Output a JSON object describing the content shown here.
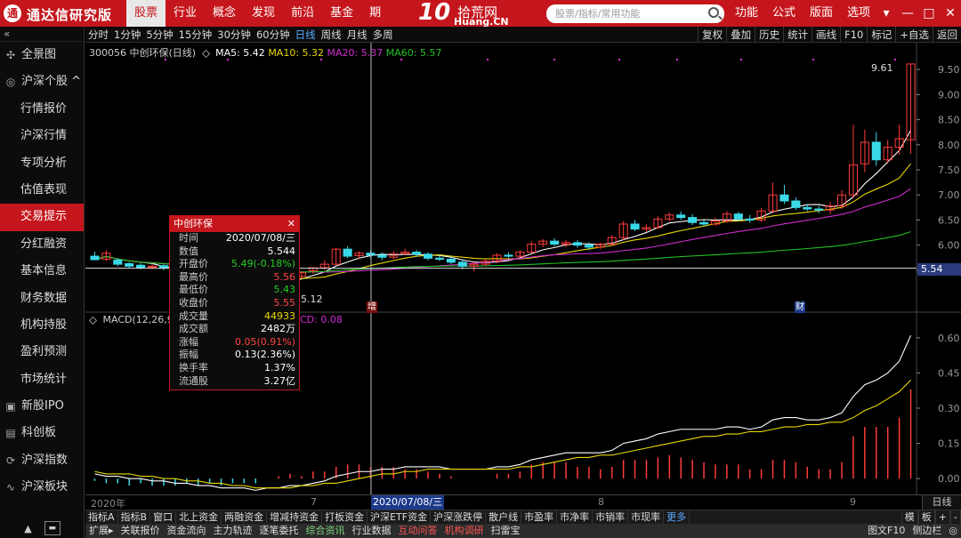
{
  "app": {
    "name": "通达信研究版",
    "logo": "通"
  },
  "menu": {
    "items": [
      "股票",
      "行业",
      "概念",
      "发现",
      "前沿",
      "基金",
      "期"
    ],
    "active": 0,
    "right": [
      "功能",
      "公式",
      "版面",
      "选项"
    ]
  },
  "watermark": {
    "big": "10",
    "t1": "拾荒网",
    "t2": "Huang.CN"
  },
  "search": {
    "placeholder": "股票/指标/常用功能"
  },
  "window": {
    "controls": [
      "▾",
      "—",
      "□",
      "✕"
    ]
  },
  "sidebar": {
    "collapse": "«",
    "items": [
      {
        "label": "全景图",
        "icon": "✣",
        "sub": false
      },
      {
        "label": "沪深个股 ^",
        "icon": "◎",
        "sub": false
      },
      {
        "label": "行情报价",
        "icon": "",
        "sub": true
      },
      {
        "label": "沪深行情",
        "icon": "",
        "sub": true
      },
      {
        "label": "专项分析",
        "icon": "",
        "sub": true
      },
      {
        "label": "估值表现",
        "icon": "",
        "sub": true
      },
      {
        "label": "交易提示",
        "icon": "",
        "sub": true,
        "active": true
      },
      {
        "label": "分红融资",
        "icon": "",
        "sub": true
      },
      {
        "label": "基本信息",
        "icon": "",
        "sub": true
      },
      {
        "label": "财务数据",
        "icon": "",
        "sub": true
      },
      {
        "label": "机构持股",
        "icon": "",
        "sub": true
      },
      {
        "label": "盈利预测",
        "icon": "",
        "sub": true
      },
      {
        "label": "市场统计",
        "icon": "",
        "sub": true
      },
      {
        "label": "新股IPO",
        "icon": "▣",
        "sub": false
      },
      {
        "label": "科创板",
        "icon": "▤",
        "sub": false
      },
      {
        "label": "沪深指数",
        "icon": "⟳",
        "sub": false
      },
      {
        "label": "沪深板块",
        "icon": "∿",
        "sub": false
      }
    ],
    "bottom": {
      "arrow": "▲",
      "btn": "▬"
    }
  },
  "periods": {
    "items": [
      "分时",
      "1分钟",
      "5分钟",
      "15分钟",
      "30分钟",
      "60分钟",
      "日线",
      "周线",
      "月线",
      "多周"
    ],
    "selected": 6,
    "tools": [
      "复权",
      "叠加",
      "历史",
      "统计",
      "画线",
      "F10",
      "标记",
      "+自选",
      "返回"
    ]
  },
  "stock": {
    "code": "300056",
    "name": "中创环保(日线)",
    "ma5": "MA5: 5.42",
    "ma10": "MA10: 5.32",
    "ma20": "MA20: 5.37",
    "ma60": "MA60: 5.57",
    "max_label": "9.61",
    "min_label": "5.12",
    "price_tag": "5.54",
    "marker_zeng": "增",
    "marker_cai": "财"
  },
  "macd": {
    "title": "MACD(12,26,9",
    "extra": "CD: 0.08"
  },
  "axes": {
    "price_ticks": [
      "9.50",
      "9.00",
      "8.50",
      "8.00",
      "7.50",
      "7.00",
      "6.50",
      "6.00",
      "5.50"
    ],
    "macd_ticks": [
      "0.60",
      "0.45",
      "0.30",
      "0.15",
      "0.00"
    ]
  },
  "datebar": {
    "labels": [
      "2020年",
      "7",
      "8",
      "9"
    ],
    "current": "2020/07/08/三",
    "period": "日线"
  },
  "info": {
    "title": "中创环保",
    "close": "✕",
    "rows": [
      {
        "k": "时间",
        "v": "2020/07/08/三",
        "c": "cw"
      },
      {
        "k": "数值",
        "v": "5.544",
        "c": "cw"
      },
      {
        "k": "开盘价",
        "v": "5.49(-0.18%)",
        "c": "cg"
      },
      {
        "k": "最高价",
        "v": "5.56",
        "c": "cr"
      },
      {
        "k": "最低价",
        "v": "5.43",
        "c": "cg"
      },
      {
        "k": "收盘价",
        "v": "5.55",
        "c": "cr"
      },
      {
        "k": "成交量",
        "v": "44933",
        "c": "cy"
      },
      {
        "k": "成交额",
        "v": "2482万",
        "c": "cw"
      },
      {
        "k": "涨幅",
        "v": "0.05(0.91%)",
        "c": "cr"
      },
      {
        "k": "振幅",
        "v": "0.13(2.36%)",
        "c": "cw"
      },
      {
        "k": "换手率",
        "v": "1.37%",
        "c": "cw"
      },
      {
        "k": "流通股",
        "v": "3.27亿",
        "c": "cw"
      }
    ]
  },
  "bottombar1": {
    "items": [
      "指标A",
      "指标B",
      "窗口",
      "北上资金",
      "两融资金",
      "增减持资金",
      "打板资金",
      "沪深ETF资金",
      "沪深涨跌停",
      "散户线",
      "市盈率",
      "市净率",
      "市销率",
      "市现率",
      "更多"
    ],
    "right": [
      "模",
      "板",
      "+",
      "-"
    ]
  },
  "bottombar2": {
    "items": [
      {
        "t": "扩展▸",
        "c": ""
      },
      {
        "t": "关联报价",
        "c": ""
      },
      {
        "t": "资金流向",
        "c": ""
      },
      {
        "t": "主力轨迹",
        "c": ""
      },
      {
        "t": "逐笔委托",
        "c": ""
      },
      {
        "t": "综合资讯",
        "c": "hg"
      },
      {
        "t": "行业数据",
        "c": ""
      },
      {
        "t": "互动问答",
        "c": "hl"
      },
      {
        "t": "机构调研",
        "c": "hl"
      },
      {
        "t": "扫雷宝",
        "c": ""
      }
    ],
    "right": [
      "图文F10",
      "侧边栏",
      "◎"
    ]
  },
  "chart_data": {
    "type": "candlestick",
    "price_axis": {
      "min": 5.12,
      "max": 9.61,
      "range": [
        5.25,
        9.75
      ]
    },
    "macd_axis": {
      "range": [
        -0.06,
        0.66
      ]
    },
    "candles": [
      [
        5.78,
        5.71,
        5.87,
        5.7
      ],
      [
        5.72,
        5.84,
        5.9,
        5.68
      ],
      [
        5.7,
        5.62,
        5.74,
        5.58
      ],
      [
        5.63,
        5.58,
        5.66,
        5.55
      ],
      [
        5.6,
        5.55,
        5.64,
        5.52
      ],
      [
        5.56,
        5.58,
        5.62,
        5.52
      ],
      [
        5.59,
        5.54,
        5.62,
        5.5
      ],
      [
        5.55,
        5.52,
        5.58,
        5.48
      ],
      [
        5.52,
        5.5,
        5.55,
        5.45
      ],
      [
        5.5,
        5.46,
        5.53,
        5.42
      ],
      [
        5.46,
        5.4,
        5.49,
        5.35
      ],
      [
        5.4,
        5.33,
        5.43,
        5.28
      ],
      [
        5.33,
        5.3,
        5.37,
        5.24
      ],
      [
        5.3,
        5.24,
        5.33,
        5.18
      ],
      [
        5.24,
        5.2,
        5.28,
        5.12
      ],
      [
        5.21,
        5.27,
        5.3,
        5.16
      ],
      [
        5.27,
        5.33,
        5.36,
        5.25
      ],
      [
        5.33,
        5.38,
        5.42,
        5.3
      ],
      [
        5.38,
        5.45,
        5.48,
        5.35
      ],
      [
        5.49,
        5.55,
        5.56,
        5.43
      ],
      [
        5.55,
        5.62,
        5.7,
        5.5
      ],
      [
        5.62,
        5.92,
        5.95,
        5.6
      ],
      [
        5.92,
        5.78,
        5.98,
        5.74
      ],
      [
        5.79,
        5.84,
        5.88,
        5.72
      ],
      [
        5.84,
        5.8,
        5.9,
        5.74
      ],
      [
        5.8,
        5.76,
        5.85,
        5.7
      ],
      [
        5.76,
        5.83,
        5.88,
        5.72
      ],
      [
        5.83,
        5.86,
        5.93,
        5.8
      ],
      [
        5.86,
        5.82,
        5.9,
        5.77
      ],
      [
        5.82,
        5.74,
        5.86,
        5.7
      ],
      [
        5.74,
        5.72,
        5.8,
        5.68
      ],
      [
        5.72,
        5.66,
        5.77,
        5.62
      ],
      [
        5.66,
        5.58,
        5.72,
        5.52
      ],
      [
        5.58,
        5.62,
        5.66,
        5.48
      ],
      [
        5.62,
        5.68,
        5.72,
        5.58
      ],
      [
        5.68,
        5.8,
        5.84,
        5.64
      ],
      [
        5.8,
        5.78,
        5.86,
        5.74
      ],
      [
        5.78,
        5.86,
        5.9,
        5.75
      ],
      [
        5.86,
        6.02,
        6.08,
        5.84
      ],
      [
        6.02,
        6.08,
        6.12,
        5.96
      ],
      [
        6.08,
        6.02,
        6.14,
        5.98
      ],
      [
        6.02,
        6.05,
        6.1,
        5.96
      ],
      [
        6.05,
        6.0,
        6.1,
        5.95
      ],
      [
        6.0,
        5.96,
        6.06,
        5.9
      ],
      [
        5.96,
        6.02,
        6.05,
        5.92
      ],
      [
        6.02,
        6.15,
        6.2,
        5.98
      ],
      [
        6.15,
        6.42,
        6.48,
        6.1
      ],
      [
        6.42,
        6.32,
        6.5,
        6.28
      ],
      [
        6.32,
        6.35,
        6.42,
        6.27
      ],
      [
        6.35,
        6.52,
        6.58,
        6.32
      ],
      [
        6.52,
        6.6,
        6.65,
        6.48
      ],
      [
        6.6,
        6.55,
        6.67,
        6.5
      ],
      [
        6.55,
        6.45,
        6.62,
        6.4
      ],
      [
        6.45,
        6.42,
        6.5,
        6.37
      ],
      [
        6.42,
        6.48,
        6.55,
        6.38
      ],
      [
        6.48,
        6.62,
        6.68,
        6.45
      ],
      [
        6.62,
        6.52,
        6.66,
        6.48
      ],
      [
        6.52,
        6.5,
        6.6,
        6.45
      ],
      [
        6.5,
        6.68,
        6.74,
        6.46
      ],
      [
        6.68,
        7.0,
        7.25,
        6.64
      ],
      [
        7.0,
        6.88,
        7.2,
        6.82
      ],
      [
        6.88,
        6.75,
        6.95,
        6.7
      ],
      [
        6.75,
        6.72,
        6.82,
        6.68
      ],
      [
        6.72,
        6.7,
        6.78,
        6.64
      ],
      [
        6.7,
        6.78,
        6.86,
        6.62
      ],
      [
        6.78,
        7.0,
        7.1,
        6.72
      ],
      [
        7.0,
        7.6,
        8.4,
        6.95
      ],
      [
        7.62,
        8.05,
        8.3,
        7.45
      ],
      [
        8.05,
        7.7,
        8.25,
        7.58
      ],
      [
        7.7,
        7.95,
        8.1,
        7.62
      ],
      [
        7.95,
        8.12,
        8.4,
        7.8
      ],
      [
        8.1,
        9.61,
        9.61,
        7.82
      ]
    ],
    "macd_dif": [
      0.02,
      0.01,
      0.01,
      0.0,
      0.0,
      -0.01,
      -0.01,
      -0.02,
      -0.02,
      -0.03,
      -0.03,
      -0.04,
      -0.04,
      -0.04,
      -0.05,
      -0.04,
      -0.04,
      -0.03,
      -0.03,
      -0.02,
      -0.01,
      0.01,
      0.02,
      0.03,
      0.03,
      0.04,
      0.04,
      0.05,
      0.05,
      0.05,
      0.05,
      0.04,
      0.04,
      0.04,
      0.04,
      0.05,
      0.05,
      0.06,
      0.08,
      0.09,
      0.1,
      0.11,
      0.11,
      0.11,
      0.11,
      0.12,
      0.15,
      0.16,
      0.17,
      0.19,
      0.2,
      0.21,
      0.21,
      0.21,
      0.21,
      0.22,
      0.22,
      0.21,
      0.22,
      0.25,
      0.26,
      0.26,
      0.25,
      0.25,
      0.26,
      0.28,
      0.35,
      0.4,
      0.42,
      0.45,
      0.5,
      0.61
    ],
    "macd_dea": [
      0.03,
      0.02,
      0.02,
      0.02,
      0.01,
      0.01,
      0.0,
      0.0,
      -0.01,
      -0.01,
      -0.02,
      -0.02,
      -0.03,
      -0.03,
      -0.04,
      -0.04,
      -0.04,
      -0.04,
      -0.03,
      -0.03,
      -0.02,
      -0.02,
      -0.01,
      0.0,
      0.01,
      0.02,
      0.02,
      0.03,
      0.03,
      0.04,
      0.04,
      0.04,
      0.04,
      0.04,
      0.04,
      0.04,
      0.04,
      0.05,
      0.05,
      0.06,
      0.07,
      0.08,
      0.09,
      0.09,
      0.1,
      0.1,
      0.11,
      0.12,
      0.13,
      0.14,
      0.15,
      0.16,
      0.17,
      0.18,
      0.18,
      0.19,
      0.19,
      0.2,
      0.2,
      0.21,
      0.22,
      0.22,
      0.23,
      0.23,
      0.24,
      0.24,
      0.26,
      0.29,
      0.31,
      0.34,
      0.37,
      0.42
    ],
    "macd_hist": [
      -0.01,
      -0.02,
      -0.02,
      -0.03,
      -0.02,
      -0.03,
      -0.03,
      -0.03,
      -0.02,
      -0.03,
      -0.02,
      -0.03,
      -0.02,
      -0.02,
      -0.02,
      0.0,
      0.01,
      0.02,
      0.01,
      0.03,
      0.03,
      0.05,
      0.06,
      0.06,
      0.05,
      0.05,
      0.05,
      0.04,
      0.04,
      0.03,
      0.02,
      0.01,
      0.0,
      0.0,
      0.0,
      0.02,
      0.02,
      0.03,
      0.06,
      0.07,
      0.07,
      0.07,
      0.05,
      0.05,
      0.04,
      0.05,
      0.08,
      0.08,
      0.08,
      0.09,
      0.1,
      0.09,
      0.08,
      0.07,
      0.06,
      0.06,
      0.06,
      0.04,
      0.04,
      0.08,
      0.08,
      0.07,
      0.05,
      0.04,
      0.04,
      0.07,
      0.18,
      0.22,
      0.22,
      0.22,
      0.26,
      0.38
    ]
  }
}
